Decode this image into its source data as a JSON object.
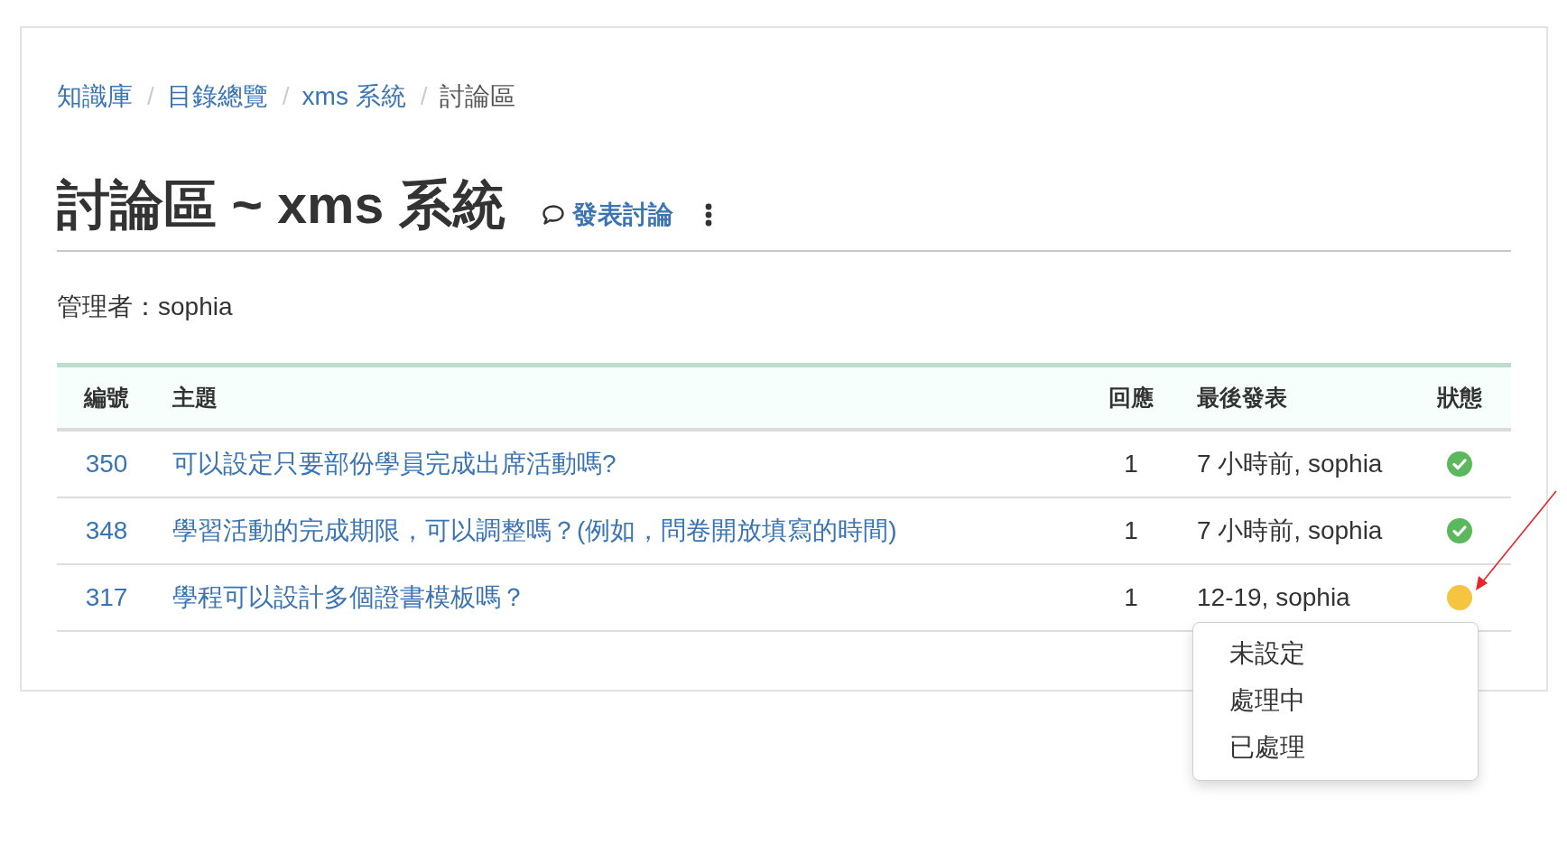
{
  "breadcrumb": [
    {
      "label": "知識庫",
      "current": false,
      "separator": "/"
    },
    {
      "label": "目錄總覽",
      "current": false,
      "separator": "/"
    },
    {
      "label": "xms 系統",
      "current": false,
      "separator": "/"
    },
    {
      "label": "討論區",
      "current": true
    }
  ],
  "page_title": "討論區 ~ xms 系統",
  "new_post_link": "發表討論",
  "manager": "管理者：sophia",
  "table": {
    "columns": [
      "編號",
      "主題",
      "回應",
      "最後發表",
      "狀態"
    ],
    "rows": [
      {
        "number": "350",
        "topic": "可以設定只要部份學員完成出席活動嗎?",
        "replies": "1",
        "last_post": "7 小時前, sophia",
        "status": {
          "kind": "check"
        },
        "menu_open": false
      },
      {
        "number": "348",
        "topic": "學習活動的完成期限，可以調整嗎？(例如，問卷開放填寫的時間)",
        "replies": "1",
        "last_post": "7 小時前, sophia",
        "status": {
          "kind": "check"
        },
        "menu_open": false
      },
      {
        "number": "317",
        "topic": "學程可以設計多個證書模板嗎？",
        "replies": "1",
        "last_post": "12-19, sophia",
        "status": {
          "kind": "dot"
        },
        "menu_open": true
      }
    ]
  },
  "status_menu": {
    "items": [
      "未設定",
      "處理中",
      "已處理"
    ]
  }
}
